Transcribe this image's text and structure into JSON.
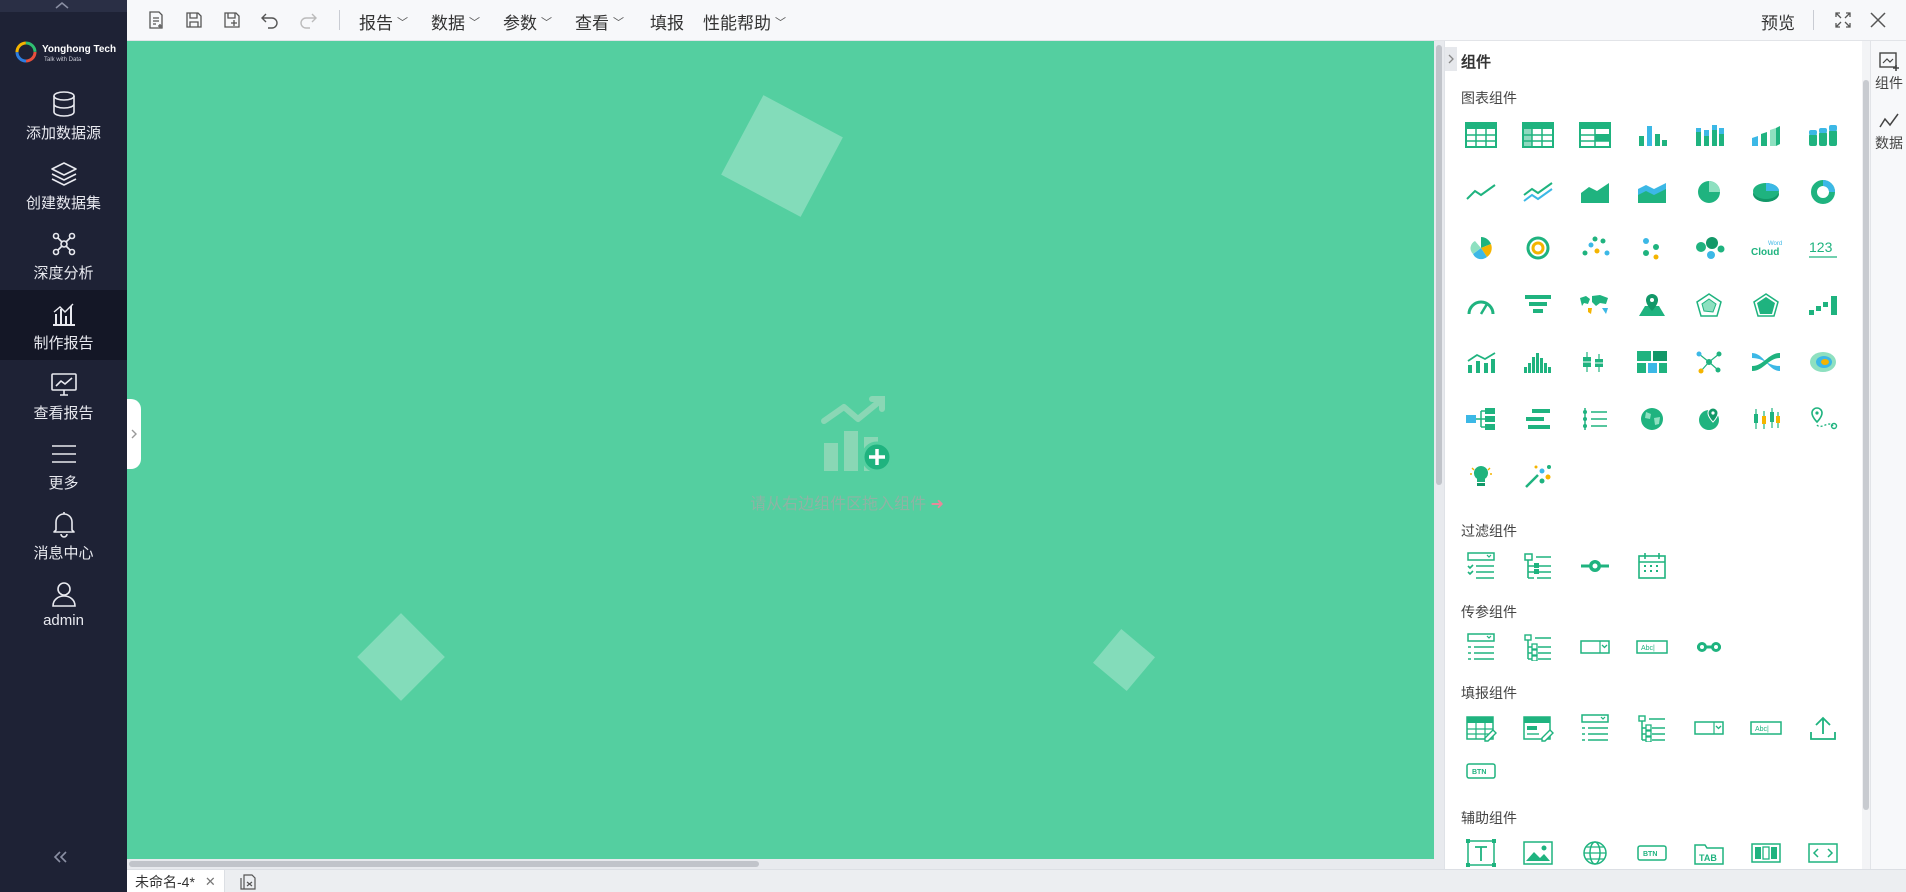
{
  "sidebar": {
    "logo": {
      "name": "Yonghong Tech",
      "tagline": "Talk with Data"
    },
    "items": [
      {
        "label": "添加数据源",
        "icon": "database-icon"
      },
      {
        "label": "创建数据集",
        "icon": "layers-icon"
      },
      {
        "label": "深度分析",
        "icon": "network-icon"
      },
      {
        "label": "制作报告",
        "icon": "bar-chart-icon",
        "active": true
      },
      {
        "label": "查看报告",
        "icon": "monitor-chart-icon"
      },
      {
        "label": "更多",
        "icon": "menu-icon"
      },
      {
        "label": "消息中心",
        "icon": "bell-icon"
      },
      {
        "label": "admin",
        "icon": "user-icon"
      }
    ]
  },
  "toolbar": {
    "menus": [
      "报告",
      "数据",
      "参数",
      "查看",
      "填报",
      "性能帮助"
    ],
    "preview_label": "预览"
  },
  "canvas": {
    "background": "#54cfa0",
    "hint": "请从右边组件区拖入组件"
  },
  "doc_tab": {
    "label": "未命名-4*"
  },
  "panel": {
    "title": "组件",
    "accent": "#1fb37f",
    "sections": {
      "chart": "图表组件",
      "filter": "过滤组件",
      "param": "传参组件",
      "fill": "填报组件",
      "aux": "辅助组件"
    },
    "wordcloud_text": {
      "small": "Word",
      "big": "Cloud"
    },
    "number_text": "123",
    "btn_text": "BTN",
    "tab_text": "TAB",
    "abc_text": "Abc|"
  },
  "strip": [
    {
      "label": "组件",
      "icon": "component-add-icon"
    },
    {
      "label": "数据",
      "icon": "data-line-icon"
    }
  ]
}
